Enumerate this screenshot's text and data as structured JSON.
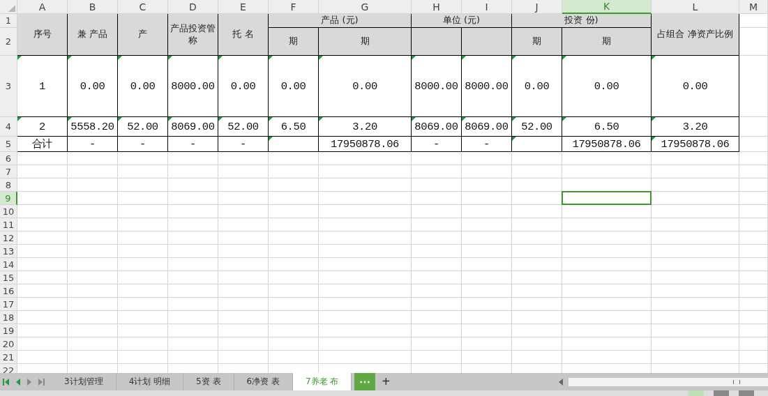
{
  "columns": [
    {
      "label": "A",
      "selected": false
    },
    {
      "label": "B",
      "selected": false
    },
    {
      "label": "C",
      "selected": false
    },
    {
      "label": "D",
      "selected": false
    },
    {
      "label": "E",
      "selected": false
    },
    {
      "label": "F",
      "selected": false
    },
    {
      "label": "G",
      "selected": false
    },
    {
      "label": "H",
      "selected": false
    },
    {
      "label": "I",
      "selected": false
    },
    {
      "label": "J",
      "selected": false
    },
    {
      "label": "K",
      "selected": true
    },
    {
      "label": "L",
      "selected": false
    },
    {
      "label": "M",
      "selected": false
    }
  ],
  "row_numbers": [
    {
      "label": "1",
      "selected": false
    },
    {
      "label": "2",
      "selected": false
    },
    {
      "label": "3",
      "selected": false
    },
    {
      "label": "4",
      "selected": false
    },
    {
      "label": "5",
      "selected": false
    },
    {
      "label": "6",
      "selected": false
    },
    {
      "label": "7",
      "selected": false
    },
    {
      "label": "8",
      "selected": false
    },
    {
      "label": "9",
      "selected": true
    },
    {
      "label": "10",
      "selected": false
    },
    {
      "label": "11",
      "selected": false
    },
    {
      "label": "12",
      "selected": false
    },
    {
      "label": "13",
      "selected": false
    },
    {
      "label": "14",
      "selected": false
    },
    {
      "label": "15",
      "selected": false
    },
    {
      "label": "16",
      "selected": false
    },
    {
      "label": "17",
      "selected": false
    },
    {
      "label": "18",
      "selected": false
    },
    {
      "label": "19",
      "selected": false
    },
    {
      "label": "20",
      "selected": false
    },
    {
      "label": "21",
      "selected": false
    },
    {
      "label": "22",
      "selected": false
    }
  ],
  "table_header": [
    {
      "text": "序号"
    },
    {
      "text": "兼 产品"
    },
    {
      "text": "产"
    },
    {
      "text": "产品投资管称"
    },
    {
      "text": "托 名"
    },
    {
      "text": "产品 (元)"
    },
    {
      "text": "期"
    },
    {
      "text": "期"
    },
    {
      "text": "单位 (元)"
    },
    {
      "text": "投资 份)"
    },
    {
      "text": "期"
    },
    {
      "text": "期"
    },
    {
      "text": "占组合 净资产比例"
    }
  ],
  "rows": [
    [
      {
        "text": "1",
        "flagged": true
      },
      {
        "text": "0.00",
        "flagged": true
      },
      {
        "text": "0.00",
        "flagged": true
      },
      {
        "text": "8000.00",
        "flagged": true
      },
      {
        "text": "0.00",
        "flagged": true
      },
      {
        "text": "0.00",
        "flagged": true
      },
      {
        "text": "0.00",
        "flagged": true
      },
      {
        "text": "8000.00",
        "flagged": true
      },
      {
        "text": "8000.00",
        "flagged": true
      },
      {
        "text": "0.00",
        "flagged": true
      },
      {
        "text": "0.00",
        "flagged": true
      },
      {
        "text": "0.00",
        "flagged": true
      }
    ],
    [
      {
        "text": "2",
        "flagged": true
      },
      {
        "text": "5558.20",
        "flagged": true
      },
      {
        "text": "52.00",
        "flagged": true
      },
      {
        "text": "8069.00",
        "flagged": true
      },
      {
        "text": "52.00",
        "flagged": true
      },
      {
        "text": "6.50",
        "flagged": true
      },
      {
        "text": "3.20",
        "flagged": true
      },
      {
        "text": "8069.00",
        "flagged": true
      },
      {
        "text": "8069.00",
        "flagged": true
      },
      {
        "text": "52.00",
        "flagged": true
      },
      {
        "text": "6.50",
        "flagged": true
      },
      {
        "text": "3.20",
        "flagged": true
      }
    ],
    [
      {
        "text": "合计",
        "flagged": false
      },
      {
        "text": "-",
        "flagged": false
      },
      {
        "text": "-",
        "flagged": false
      },
      {
        "text": "-",
        "flagged": false
      },
      {
        "text": "-",
        "flagged": false
      },
      {
        "flagged": true
      },
      {
        "text": "17950878.06",
        "flagged": false
      },
      {
        "text": "-",
        "flagged": false
      },
      {
        "text": "-",
        "flagged": false
      },
      {
        "flagged": true
      },
      {
        "text": "17950878.06",
        "flagged": false
      },
      {
        "text": "17950878.06",
        "flagged": true
      }
    ]
  ],
  "sheet_tabs": [
    {
      "label": "3计划管理",
      "selected": false
    },
    {
      "label": "4计划 明细",
      "selected": false
    },
    {
      "label": "5资 表",
      "selected": false
    },
    {
      "label": "6净资 表",
      "selected": false
    },
    {
      "label": "7养老 布",
      "selected": true
    }
  ],
  "more_tabs": "⋯",
  "add_tab": "+"
}
